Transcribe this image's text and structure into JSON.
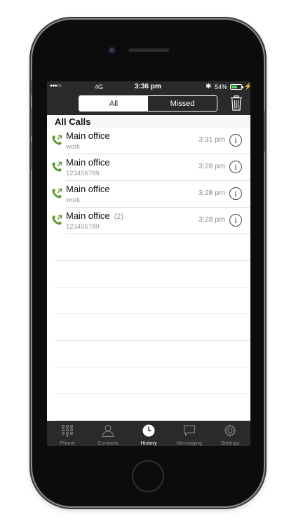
{
  "status_bar": {
    "signal": "●●●○○",
    "network": "4G",
    "time": "3:36 pm",
    "bluetooth": "✱",
    "battery_percent": "54%",
    "battery_level": 0.54
  },
  "toolbar": {
    "segments": [
      "All",
      "Missed"
    ],
    "selected_segment": "All"
  },
  "section_title": "All Calls",
  "calls": [
    {
      "name": "Main office",
      "count": "",
      "subtitle": "work",
      "time": "3:31 pm"
    },
    {
      "name": "Main office",
      "count": "",
      "subtitle": "123456789",
      "time": "3:28 pm"
    },
    {
      "name": "Main office",
      "count": "",
      "subtitle": "work",
      "time": "3:28 pm"
    },
    {
      "name": "Main office",
      "count": "(2)",
      "subtitle": "123456789",
      "time": "3:28 pm"
    }
  ],
  "tabs": [
    {
      "label": "Phone",
      "icon": "keypad-icon"
    },
    {
      "label": "Contacts",
      "icon": "person-icon"
    },
    {
      "label": "History",
      "icon": "clock-icon",
      "active": true
    },
    {
      "label": "Messaging",
      "icon": "chat-bubble-icon"
    },
    {
      "label": "Settings",
      "icon": "gear-icon"
    }
  ],
  "colors": {
    "call_icon": "#5a9a2a",
    "bar_bg": "#2a2a2a",
    "battery_fill": "#4cd964"
  }
}
